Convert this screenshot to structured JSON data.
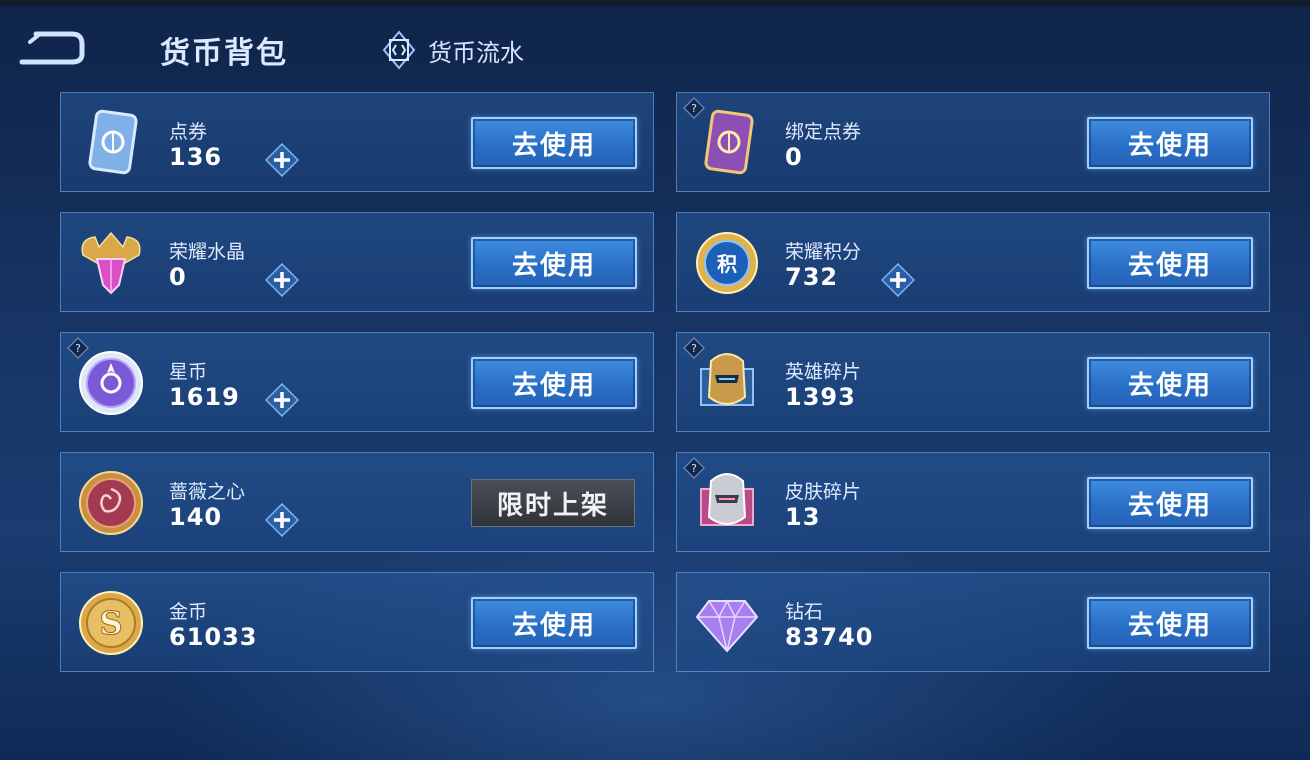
{
  "header": {
    "title": "货币背包",
    "flow_tab_label": "货币流水"
  },
  "currencies": [
    {
      "name": "点券",
      "amount": "136",
      "button": "去使用"
    },
    {
      "name": "绑定点券",
      "amount": "0",
      "button": "去使用"
    },
    {
      "name": "荣耀水晶",
      "amount": "0",
      "button": "去使用"
    },
    {
      "name": "荣耀积分",
      "amount": "732",
      "button": "去使用"
    },
    {
      "name": "星币",
      "amount": "1619",
      "button": "去使用"
    },
    {
      "name": "英雄碎片",
      "amount": "1393",
      "button": "去使用"
    },
    {
      "name": "蔷薇之心",
      "amount": "140",
      "button": "限时上架"
    },
    {
      "name": "皮肤碎片",
      "amount": "13",
      "button": "去使用"
    },
    {
      "name": "金币",
      "amount": "61033",
      "button": "去使用"
    },
    {
      "name": "钻石",
      "amount": "83740",
      "button": "去使用"
    }
  ],
  "icons": {
    "back": "back-arrow-icon",
    "flow": "ledger-diamond-icon",
    "plus": "plus-icon",
    "help": "question-mark-icon"
  },
  "colors": {
    "accent": "#2f7ad6",
    "button_border": "#9fd0ff",
    "limited_button": "#3a3e45"
  }
}
